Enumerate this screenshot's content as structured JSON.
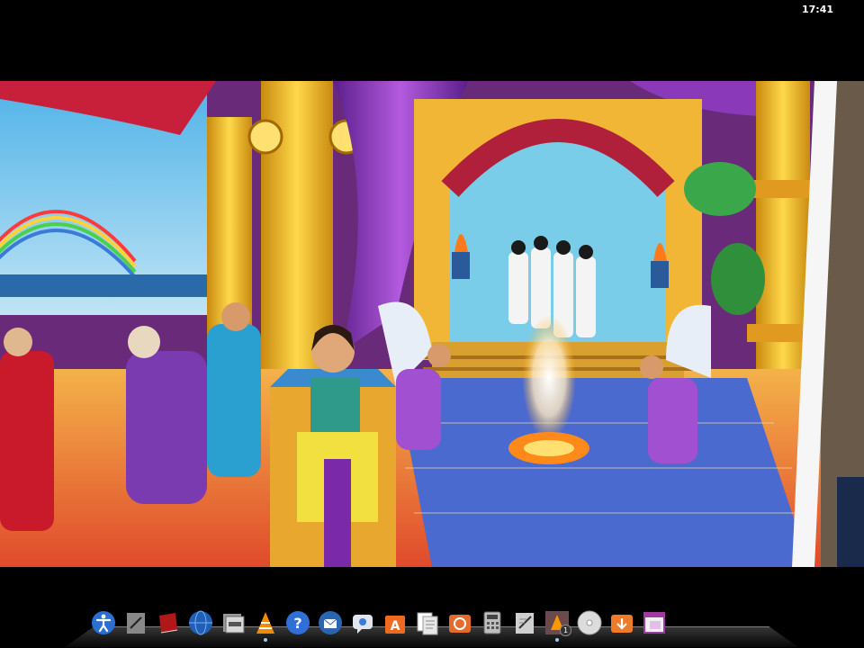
{
  "status_bar": {
    "time": "17:41"
  },
  "video": {
    "description_icon": "video-frame"
  },
  "dock": {
    "items": [
      {
        "name": "accessibility",
        "icon": "accessibility-icon",
        "color": "#2a6fd1"
      },
      {
        "name": "text-editor",
        "icon": "text-editor-icon",
        "color": "#888888"
      },
      {
        "name": "book-reader",
        "icon": "book-icon",
        "color": "#b01818"
      },
      {
        "name": "web-browser",
        "icon": "globe-icon",
        "color": "#1f5fb8"
      },
      {
        "name": "file-manager",
        "icon": "file-manager-icon",
        "color": "#9a9a9a"
      },
      {
        "name": "vlc-player",
        "icon": "vlc-icon",
        "color": "#f08a00"
      },
      {
        "name": "help",
        "icon": "help-icon",
        "color": "#2f6fd6"
      },
      {
        "name": "thunderbird-mail",
        "icon": "mail-icon",
        "color": "#2b64b0"
      },
      {
        "name": "messenger",
        "icon": "chat-icon",
        "color": "#dfe6f0"
      },
      {
        "name": "app-store",
        "icon": "store-icon",
        "color": "#ee6a1e"
      },
      {
        "name": "documents",
        "icon": "documents-icon",
        "color": "#e8e8e8"
      },
      {
        "name": "backup",
        "icon": "backup-icon",
        "color": "#e36b2b"
      },
      {
        "name": "calculator",
        "icon": "calculator-icon",
        "color": "#bfbfbf"
      },
      {
        "name": "notes",
        "icon": "notes-icon",
        "color": "#d0d0d0"
      },
      {
        "name": "vlc-window",
        "icon": "vlc-window-icon",
        "color": "#ff9800",
        "badge": "1"
      },
      {
        "name": "dvd-player",
        "icon": "disc-icon",
        "color": "#dcdcdc"
      },
      {
        "name": "downloads",
        "icon": "downloads-icon",
        "color": "#ee7a2a"
      },
      {
        "name": "window-manager",
        "icon": "window-icon",
        "color": "#a03aa0"
      }
    ]
  }
}
